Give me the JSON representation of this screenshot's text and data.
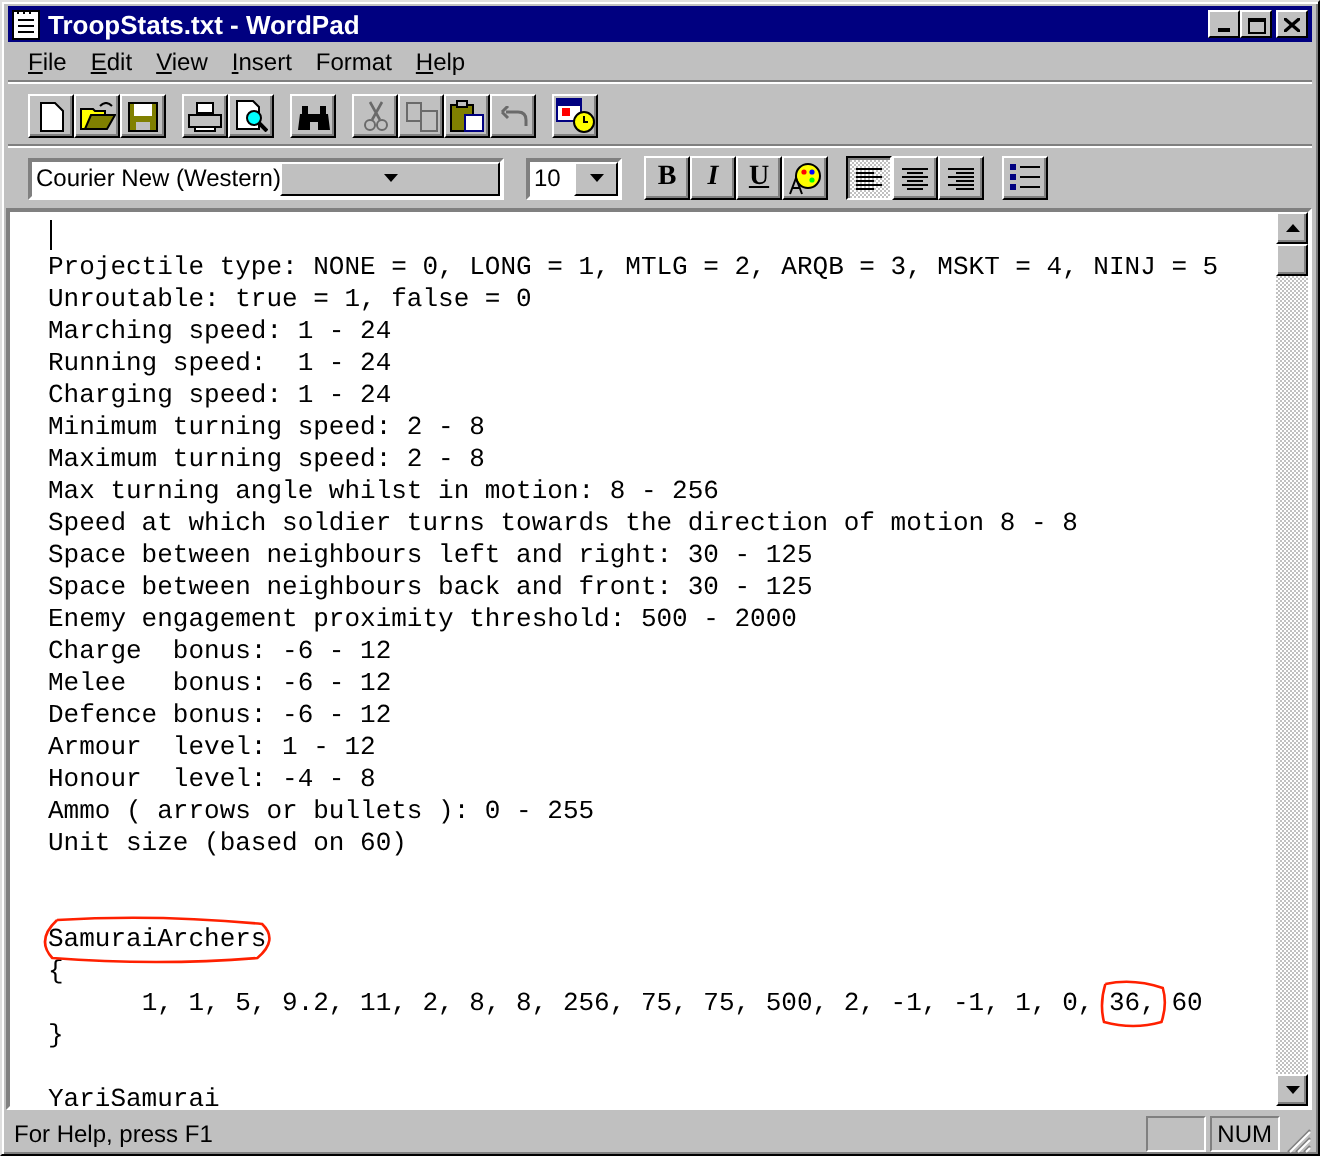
{
  "window": {
    "title": "TroopStats.txt - WordPad"
  },
  "menu": [
    {
      "label": "File",
      "underline_first": true
    },
    {
      "label": "Edit",
      "underline_first": true
    },
    {
      "label": "View",
      "underline_first": true
    },
    {
      "label": "Insert",
      "underline_first": true
    },
    {
      "label": "Format",
      "underline_first": false
    },
    {
      "label": "Help",
      "underline_first": true
    }
  ],
  "toolbar": [
    {
      "kind": "new",
      "disabled": false
    },
    {
      "kind": "open",
      "disabled": false
    },
    {
      "kind": "save",
      "disabled": false
    },
    {
      "kind": "sep"
    },
    {
      "kind": "print",
      "disabled": false
    },
    {
      "kind": "preview",
      "disabled": false
    },
    {
      "kind": "sep"
    },
    {
      "kind": "find",
      "disabled": false
    },
    {
      "kind": "sep"
    },
    {
      "kind": "cut",
      "disabled": true
    },
    {
      "kind": "copy",
      "disabled": true
    },
    {
      "kind": "paste",
      "disabled": false
    },
    {
      "kind": "undo",
      "disabled": true
    },
    {
      "kind": "sep"
    },
    {
      "kind": "datetime",
      "disabled": false
    }
  ],
  "format_bar": {
    "font": "Courier New (Western)",
    "size": "10",
    "buttons": [
      {
        "kind": "bold",
        "label": "B",
        "selected": false
      },
      {
        "kind": "italic",
        "label": "I",
        "selected": false
      },
      {
        "kind": "underline",
        "label": "U",
        "selected": false
      },
      {
        "kind": "color",
        "selected": false
      },
      {
        "kind": "sep"
      },
      {
        "kind": "align-left",
        "selected": true
      },
      {
        "kind": "align-center",
        "selected": false
      },
      {
        "kind": "align-right",
        "selected": false
      },
      {
        "kind": "sep"
      },
      {
        "kind": "bullets",
        "selected": false
      }
    ]
  },
  "document": {
    "lines": [
      {
        "kind": "caret"
      },
      {
        "kind": "text",
        "text": "Projectile type: NONE = 0, LONG = 1, MTLG = 2, ARQB = 3, MSKT = 4, NINJ = 5"
      },
      {
        "kind": "text",
        "text": "Unroutable: true = 1, false = 0"
      },
      {
        "kind": "text",
        "text": "Marching speed: 1 - 24"
      },
      {
        "kind": "text",
        "text": "Running speed:  1 - 24"
      },
      {
        "kind": "text",
        "text": "Charging speed: 1 - 24"
      },
      {
        "kind": "text",
        "text": "Minimum turning speed: 2 - 8"
      },
      {
        "kind": "text",
        "text": "Maximum turning speed: 2 - 8"
      },
      {
        "kind": "text",
        "text": "Max turning angle whilst in motion: 8 - 256"
      },
      {
        "kind": "text",
        "text": "Speed at which soldier turns towards the direction of motion 8 - 8"
      },
      {
        "kind": "text",
        "text": "Space between neighbours left and right: 30 - 125"
      },
      {
        "kind": "text",
        "text": "Space between neighbours back and front: 30 - 125"
      },
      {
        "kind": "text",
        "text": "Enemy engagement proximity threshold: 500 - 2000"
      },
      {
        "kind": "text",
        "text": "Charge  bonus: -6 - 12"
      },
      {
        "kind": "text",
        "text": "Melee   bonus: -6 - 12"
      },
      {
        "kind": "text",
        "text": "Defence bonus: -6 - 12"
      },
      {
        "kind": "text",
        "text": "Armour  level: 1 - 12"
      },
      {
        "kind": "text",
        "text": "Honour  level: -4 - 8"
      },
      {
        "kind": "text",
        "text": "Ammo ( arrows or bullets ): 0 - 255"
      },
      {
        "kind": "text",
        "text": "Unit size (based on 60)"
      },
      {
        "kind": "blank"
      },
      {
        "kind": "blank"
      },
      {
        "kind": "segments",
        "segments": [
          {
            "text": "SamuraiArchers",
            "circled": true
          }
        ]
      },
      {
        "kind": "text",
        "text": "{"
      },
      {
        "kind": "segments",
        "segments": [
          {
            "text": "\t1, 1, 5, 9.2, 11, 2, 8, 8, 256, 75, 75, 500, 2, -1, -1, 1, 0, ",
            "circled": false
          },
          {
            "text": "36,",
            "circled": true
          },
          {
            "text": " 60",
            "circled": false
          }
        ]
      },
      {
        "kind": "text",
        "text": "}"
      },
      {
        "kind": "blank"
      },
      {
        "kind": "text",
        "text": "YariSamurai"
      }
    ]
  },
  "status_bar": {
    "help": "For Help, press F1",
    "num": "NUM"
  }
}
